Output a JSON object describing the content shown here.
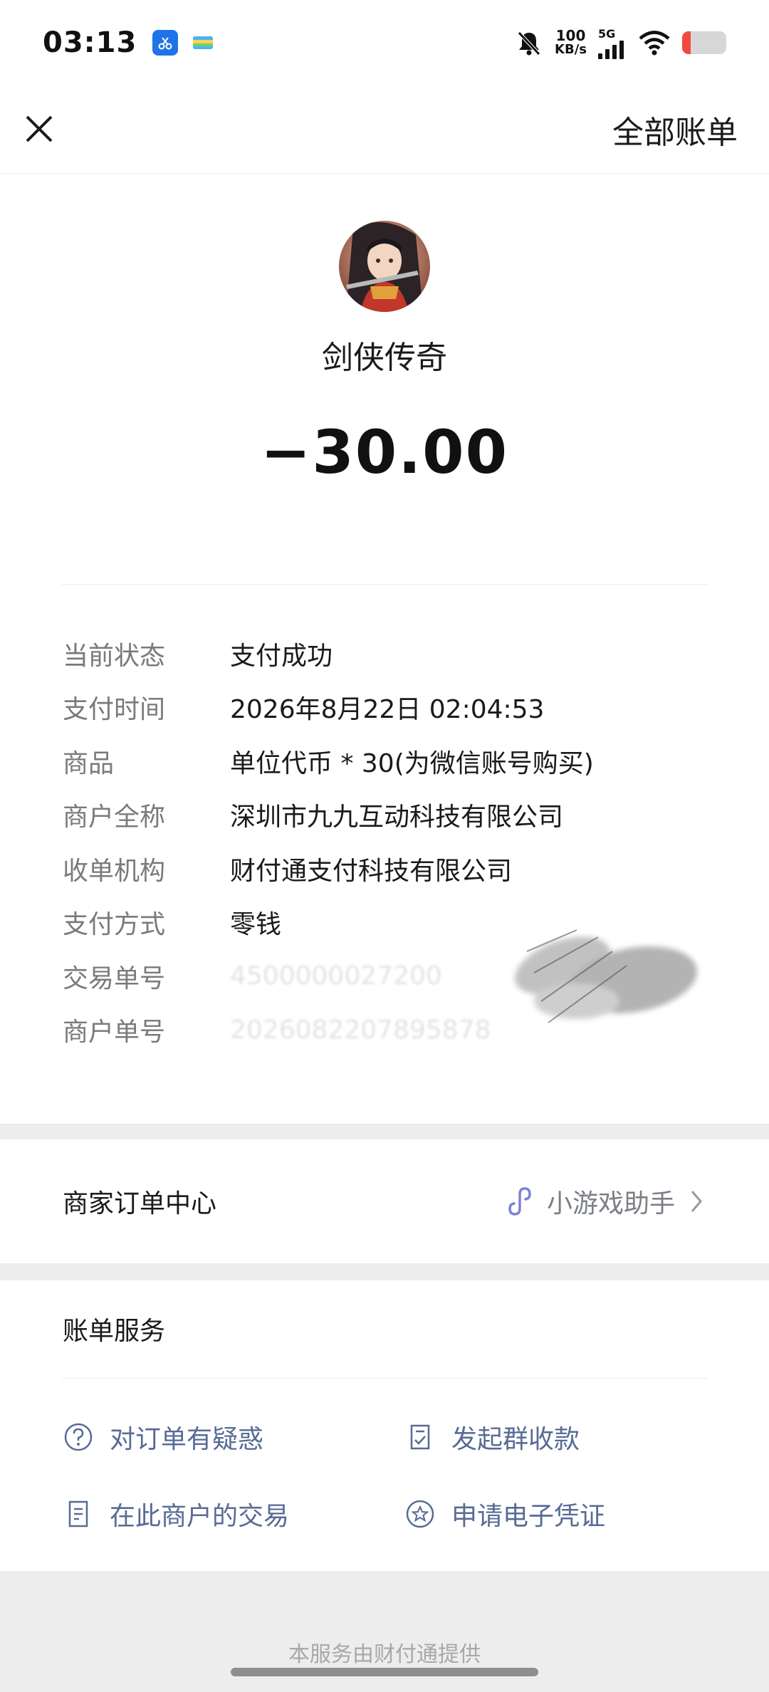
{
  "status_bar": {
    "time": "03:13",
    "net_speed_value": "100",
    "net_speed_unit": "KB/s",
    "network_type": "5G",
    "battery_level": 0.2,
    "battery_color": "#f04b3c"
  },
  "nav": {
    "close_icon": "close-icon",
    "all_bills": "全部账单"
  },
  "header": {
    "merchant_name": "剑侠传奇",
    "amount": "−30.00"
  },
  "details": [
    {
      "key": "当前状态",
      "value": "支付成功"
    },
    {
      "key": "支付时间",
      "value": "2026年8月22日 02:04:53"
    },
    {
      "key": "商品",
      "value": "单位代币 * 30(为微信账号购买)"
    },
    {
      "key": "商户全称",
      "value": "深圳市九九互动科技有限公司"
    },
    {
      "key": "收单机构",
      "value": "财付通支付科技有限公司"
    },
    {
      "key": "支付方式",
      "value": "零钱"
    },
    {
      "key": "交易单号",
      "value": "4500000027200"
    },
    {
      "key": "商户单号",
      "value": "2026082207895878"
    }
  ],
  "order_center": {
    "title": "商家订单中心",
    "link_label": "小游戏助手",
    "link_icon": "mini-program-icon"
  },
  "bill_services": {
    "title": "账单服务",
    "items": [
      {
        "label": "对订单有疑惑",
        "icon": "question-icon"
      },
      {
        "label": "发起群收款",
        "icon": "group-collect-icon"
      },
      {
        "label": "在此商户的交易",
        "icon": "document-icon"
      },
      {
        "label": "申请电子凭证",
        "icon": "star-badge-icon"
      }
    ]
  },
  "footer": {
    "text": "本服务由财付通提供"
  },
  "colors": {
    "link": "#576b95",
    "label_gray": "#7a7a7a",
    "divider_band": "#ededed"
  }
}
